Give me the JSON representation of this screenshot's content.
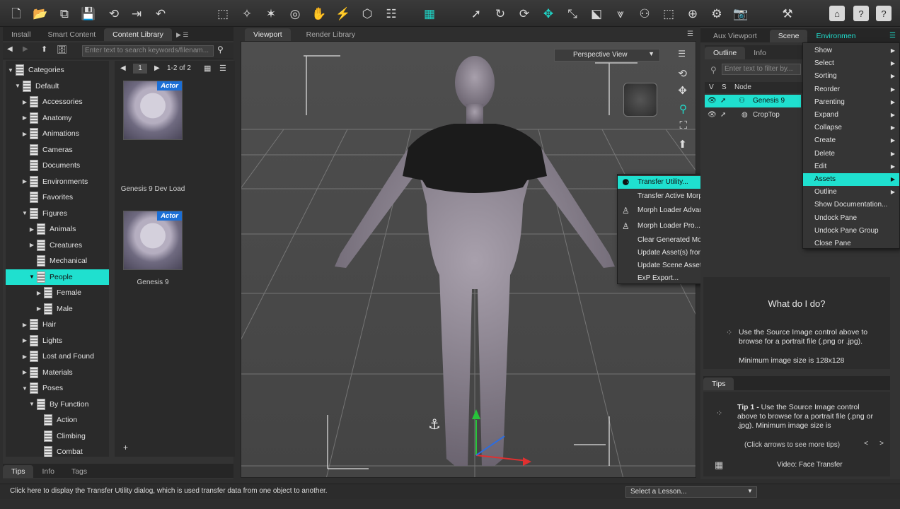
{
  "toolbar": {
    "icons": [
      "new-file-icon",
      "open-folder-icon",
      "merge-icon",
      "save-icon",
      "undo-history-icon",
      "export-icon",
      "undo-icon",
      "node-select-icon",
      "universal-tool-icon",
      "joint-editor-icon",
      "region-nav-icon",
      "active-pose-icon",
      "node-weight-icon",
      "geometry-editor-icon",
      "grid-tool-icon",
      "scene-navigator-icon",
      "pointer-icon",
      "rotate-icon",
      "twist-icon",
      "translate-icon",
      "scale-icon",
      "surface-selection-icon",
      "morph-icon",
      "figure-icon",
      "spot-render-icon",
      "aim-icon",
      "power-pose-icon",
      "camera-icon",
      "render-settings-icon",
      "home-icon",
      "help-icon",
      "info-icon"
    ]
  },
  "left_panel": {
    "tabs": [
      {
        "label": "Install"
      },
      {
        "label": "Smart Content"
      },
      {
        "label": "Content Library"
      }
    ],
    "search_placeholder": "Enter text to search keywords/filenam...",
    "tree": [
      {
        "label": "Categories",
        "level": 0,
        "arrow": "▼"
      },
      {
        "label": "Default",
        "level": 1,
        "arrow": "▼"
      },
      {
        "label": "Accessories",
        "level": 2,
        "arrow": "▶"
      },
      {
        "label": "Anatomy",
        "level": 2,
        "arrow": "▶"
      },
      {
        "label": "Animations",
        "level": 2,
        "arrow": "▶"
      },
      {
        "label": "Cameras",
        "level": 2,
        "arrow": ""
      },
      {
        "label": "Documents",
        "level": 2,
        "arrow": ""
      },
      {
        "label": "Environments",
        "level": 2,
        "arrow": "▶"
      },
      {
        "label": "Favorites",
        "level": 2,
        "arrow": ""
      },
      {
        "label": "Figures",
        "level": 2,
        "arrow": "▼"
      },
      {
        "label": "Animals",
        "level": 3,
        "arrow": "▶"
      },
      {
        "label": "Creatures",
        "level": 3,
        "arrow": "▶"
      },
      {
        "label": "Mechanical",
        "level": 3,
        "arrow": ""
      },
      {
        "label": "People",
        "level": 3,
        "arrow": "▼",
        "selected": true
      },
      {
        "label": "Female",
        "level": 4,
        "arrow": "▶"
      },
      {
        "label": "Male",
        "level": 4,
        "arrow": "▶"
      },
      {
        "label": "Hair",
        "level": 2,
        "arrow": "▶"
      },
      {
        "label": "Lights",
        "level": 2,
        "arrow": "▶"
      },
      {
        "label": "Lost and Found",
        "level": 2,
        "arrow": "▶"
      },
      {
        "label": "Materials",
        "level": 2,
        "arrow": "▶"
      },
      {
        "label": "Poses",
        "level": 2,
        "arrow": "▼"
      },
      {
        "label": "By Function",
        "level": 3,
        "arrow": "▼"
      },
      {
        "label": "Action",
        "level": 4,
        "arrow": ""
      },
      {
        "label": "Climbing",
        "level": 4,
        "arrow": ""
      },
      {
        "label": "Combat",
        "level": 4,
        "arrow": ""
      }
    ],
    "pager": {
      "page": "1",
      "range": "1-2 of 2"
    },
    "tiles": [
      {
        "badge": "Actor",
        "label": "Genesis 9 Dev Load"
      },
      {
        "badge": "Actor",
        "label": "Genesis 9"
      }
    ],
    "bottom_tabs": [
      {
        "label": "Tips"
      },
      {
        "label": "Info"
      },
      {
        "label": "Tags"
      }
    ]
  },
  "viewport": {
    "tabs": [
      {
        "label": "Viewport"
      },
      {
        "label": "Render Library"
      }
    ],
    "view_mode": "Perspective View"
  },
  "context_menu": {
    "items": [
      {
        "label": "Transfer Utility...",
        "icon": "transfer-utility-icon",
        "highlight": true
      },
      {
        "label": "Transfer Active Morphs",
        "icon": ""
      },
      {
        "label": "Morph Loader Advanced...",
        "icon": "morph-loader-icon"
      },
      {
        "label": "Morph Loader Pro...",
        "icon": "morph-loader-icon"
      },
      {
        "label": "Clear Generated Morphs",
        "icon": ""
      },
      {
        "label": "Update Asset(s) from Import Source(s)...",
        "icon": ""
      },
      {
        "label": "Update Scene Asset(s) from Import Source(s)...",
        "icon": ""
      },
      {
        "label": "ExP Export...",
        "icon": ""
      }
    ]
  },
  "right_panel": {
    "tabs": [
      {
        "label": "Aux Viewport"
      },
      {
        "label": "Scene"
      },
      {
        "label": "Environmen"
      }
    ],
    "subtabs": [
      {
        "label": "Outline"
      },
      {
        "label": "Info"
      }
    ],
    "filter_placeholder": "Enter text to filter by...",
    "columns": {
      "v": "V",
      "s": "S",
      "node": "Node"
    },
    "nodes": [
      {
        "label": "Genesis 9",
        "selected": true
      },
      {
        "label": "CropTop",
        "selected": false
      }
    ],
    "pane_menu": [
      {
        "label": "Show",
        "sub": true
      },
      {
        "label": "Select",
        "sub": true
      },
      {
        "label": "Sorting",
        "sub": true
      },
      {
        "label": "Reorder",
        "sub": true
      },
      {
        "label": "Parenting",
        "sub": true
      },
      {
        "label": "Expand",
        "sub": true
      },
      {
        "label": "Collapse",
        "sub": true
      },
      {
        "label": "Create",
        "sub": true
      },
      {
        "label": "Delete",
        "sub": true
      },
      {
        "label": "Edit",
        "sub": true
      },
      {
        "label": "Assets",
        "sub": true,
        "highlight": true
      },
      {
        "label": "Outline",
        "sub": true
      },
      {
        "label": "Show Documentation...",
        "sub": false
      },
      {
        "label": "Undock Pane",
        "sub": false
      },
      {
        "label": "Undock Pane Group",
        "sub": false
      },
      {
        "label": "Close Pane",
        "sub": false
      }
    ],
    "help": {
      "title": "What do I do?",
      "body": "Use the Source Image control above to browse for a portrait file (.png or .jpg).",
      "min_size": "Minimum image size is 128x128"
    },
    "tips": {
      "tab": "Tips",
      "tip_label": "Tip 1 -",
      "tip_text": "Use the Source Image control above to browse for a portrait file (.png or .jpg). Minimum image size is",
      "nav_hint": "(Click arrows to see more tips)",
      "prev": "<",
      "next": ">",
      "video": "Video: Face Transfer"
    }
  },
  "status_bar": {
    "message": "Click here to display the Transfer Utility dialog, which is used transfer data from one object to another.",
    "lesson_placeholder": "Select a Lesson..."
  },
  "colors": {
    "accent": "#1fe0cf",
    "badge": "#1b6fd6"
  }
}
